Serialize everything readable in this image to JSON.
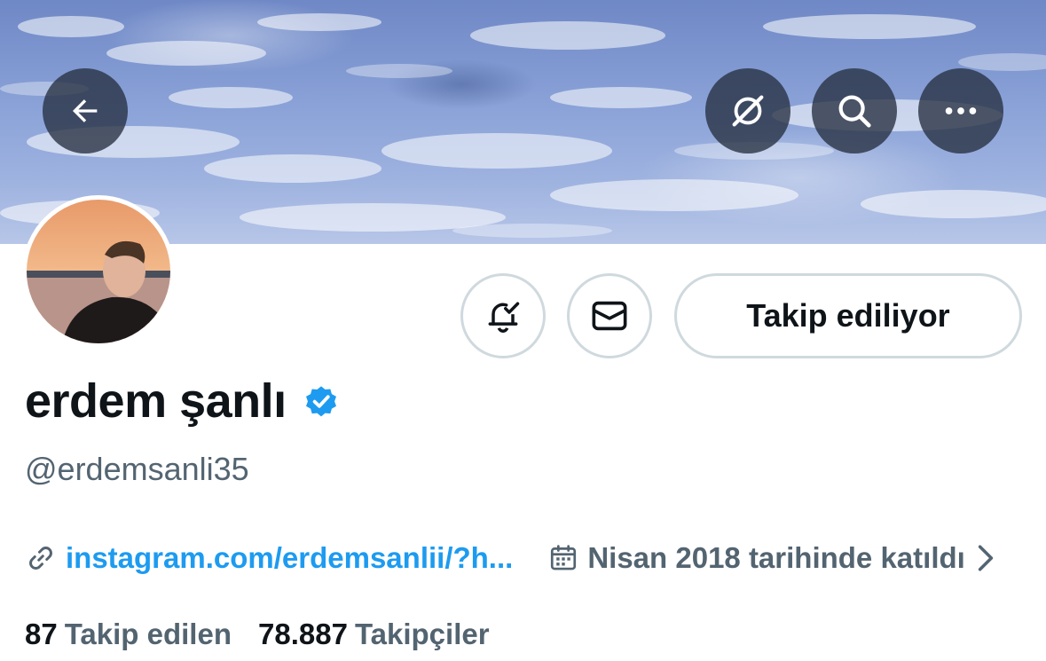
{
  "header": {
    "back_icon": "arrow-left-icon",
    "grok_icon": "grok-icon",
    "search_icon": "search-icon",
    "more_icon": "more-horizontal-icon"
  },
  "profile": {
    "display_name": "erdem şanlı",
    "handle": "@erdemsanli35",
    "verified": true,
    "verified_color": "#1d9bf0"
  },
  "actions": {
    "notify_icon": "bell-check-icon",
    "message_icon": "envelope-icon",
    "follow_label": "Takip ediliyor"
  },
  "meta": {
    "link_text": "instagram.com/erdemsanlii/?h...",
    "joined_text": "Nisan 2018 tarihinde katıldı"
  },
  "stats": {
    "following_count": "87",
    "following_label": "Takip edilen",
    "followers_count": "78.887",
    "followers_label": "Takipçiler"
  },
  "colors": {
    "accent": "#1d9bf0",
    "secondary_text": "#536471",
    "border": "#cfd9de"
  }
}
